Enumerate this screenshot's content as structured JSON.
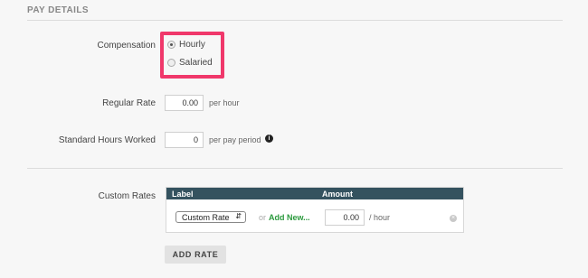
{
  "section": {
    "title": "PAY DETAILS"
  },
  "compensation": {
    "label": "Compensation",
    "options": [
      {
        "label": "Hourly",
        "checked": true
      },
      {
        "label": "Salaried",
        "checked": false
      }
    ]
  },
  "regular_rate": {
    "label": "Regular Rate",
    "value": "0.00",
    "unit": "per hour"
  },
  "standard_hours": {
    "label": "Standard Hours Worked",
    "value": "0",
    "unit": "per pay period",
    "info_icon": "info-icon"
  },
  "custom_rates": {
    "label": "Custom Rates",
    "columns": [
      "Label",
      "Amount"
    ],
    "row": {
      "select_value": "Custom Rate",
      "or_text": "or",
      "add_new": "Add New...",
      "amount": "0.00",
      "unit": "/ hour"
    },
    "add_button": "ADD RATE"
  },
  "colors": {
    "highlight": "#f0386b",
    "table_header": "#34525f",
    "link_green": "#2c9a3e"
  }
}
